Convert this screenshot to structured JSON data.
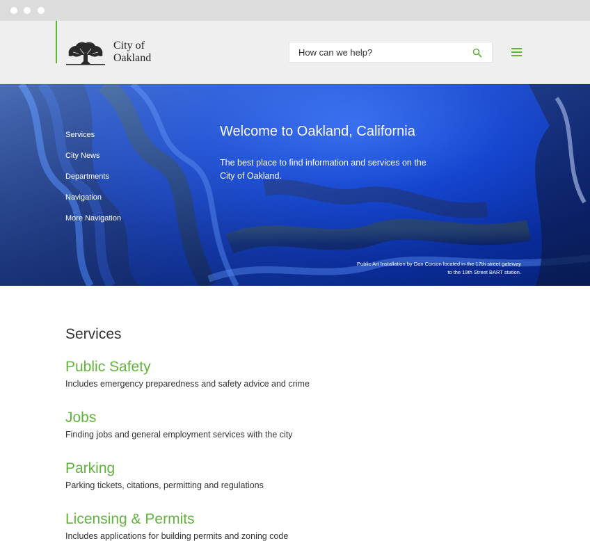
{
  "header": {
    "logo_line1": "City of",
    "logo_line2": "Oakland",
    "logo_icon": "oak-tree-icon",
    "search_placeholder": "How can we help?",
    "search_icon": "search-icon",
    "menu_icon": "hamburger-menu-icon",
    "accent": "#62b33b"
  },
  "hero": {
    "nav": [
      {
        "label": "Services"
      },
      {
        "label": "City News"
      },
      {
        "label": "Departments"
      },
      {
        "label": "Navigation"
      },
      {
        "label": "More Navigation"
      }
    ],
    "title": "Welcome to Oakland, California",
    "subtitle": "The best place to find information and services on the City of Oakland.",
    "caption": "Public Art Installation by Dan Corson located in the 17th street gateway to the 19th Street BART station."
  },
  "services": {
    "heading": "Services",
    "items": [
      {
        "title": "Public Safety",
        "description": "Includes emergency preparedness and safety advice and crime"
      },
      {
        "title": "Jobs",
        "description": "Finding jobs and general employment services with the city"
      },
      {
        "title": "Parking",
        "description": "Parking tickets, citations, permitting and regulations"
      },
      {
        "title": "Licensing & Permits",
        "description": "Includes applications for building permits and zoning code"
      }
    ]
  }
}
